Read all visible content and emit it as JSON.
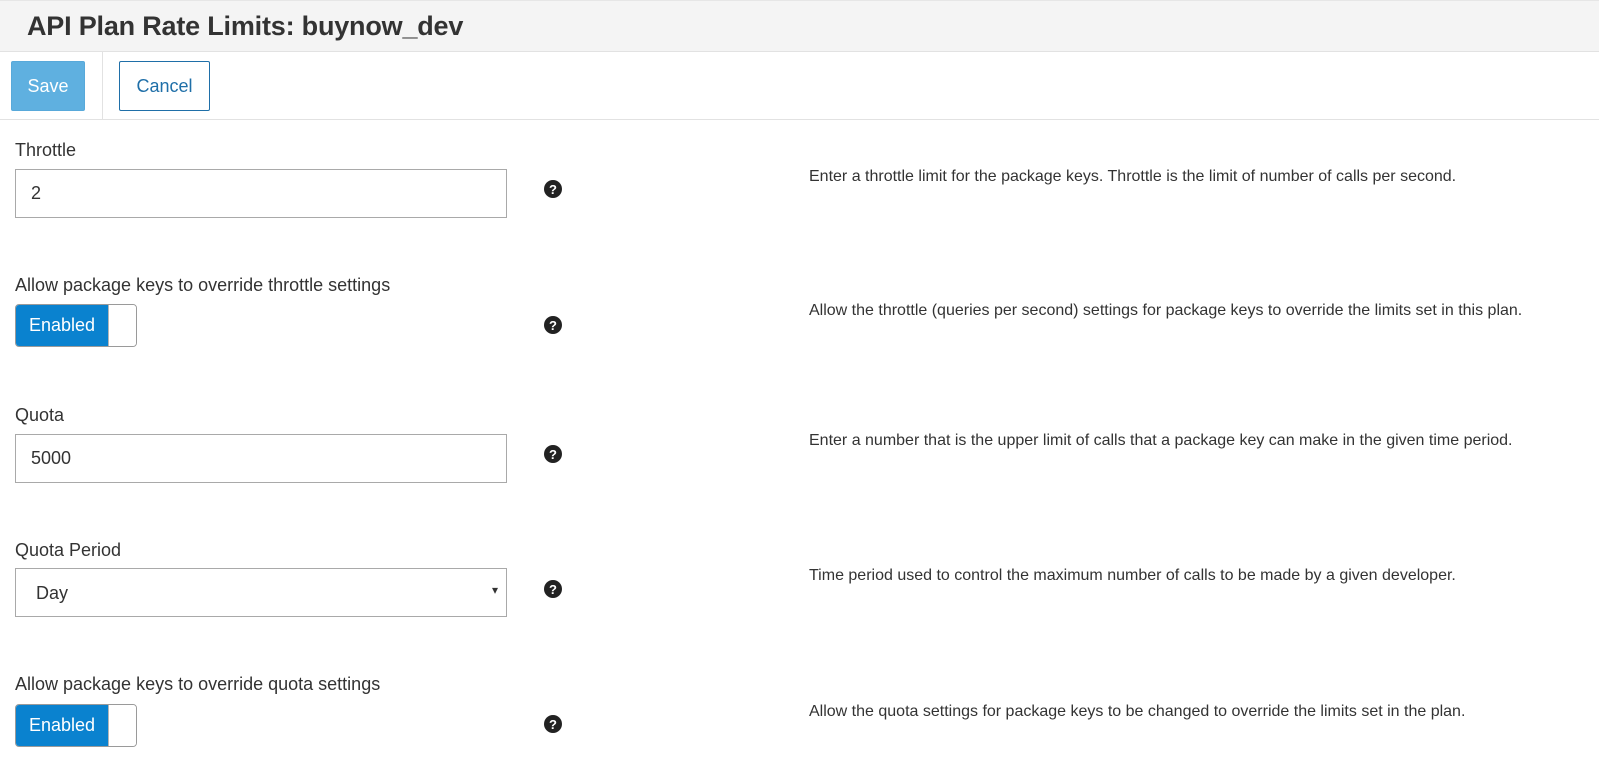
{
  "header": {
    "title": "API Plan Rate Limits: buynow_dev"
  },
  "toolbar": {
    "save_label": "Save",
    "cancel_label": "Cancel"
  },
  "fields": {
    "throttle": {
      "label": "Throttle",
      "value": "2",
      "description": "Enter a throttle limit for the package keys. Throttle is the limit of number of calls per second."
    },
    "override_throttle": {
      "label": "Allow package keys to override throttle settings",
      "toggle_label": "Enabled",
      "enabled": true,
      "description": "Allow the throttle (queries per second) settings for package keys to override the limits set in this plan."
    },
    "quota": {
      "label": "Quota",
      "value": "5000",
      "description": "Enter a number that is the upper limit of calls that a package key can make in the given time period."
    },
    "quota_period": {
      "label": "Quota Period",
      "selected": "Day",
      "description": "Time period used to control the maximum number of calls to be made by a given developer."
    },
    "override_quota": {
      "label": "Allow package keys to override quota settings",
      "toggle_label": "Enabled",
      "enabled": true,
      "description": "Allow the quota settings for package keys to be changed to override the limits set in the plan."
    }
  },
  "icons": {
    "help": "question-circle-icon",
    "help_glyph": "?",
    "caret": "▾"
  },
  "colors": {
    "primary": "#0a82cf",
    "save_button": "#5fb0e0",
    "cancel_text": "#1f6fa8"
  }
}
